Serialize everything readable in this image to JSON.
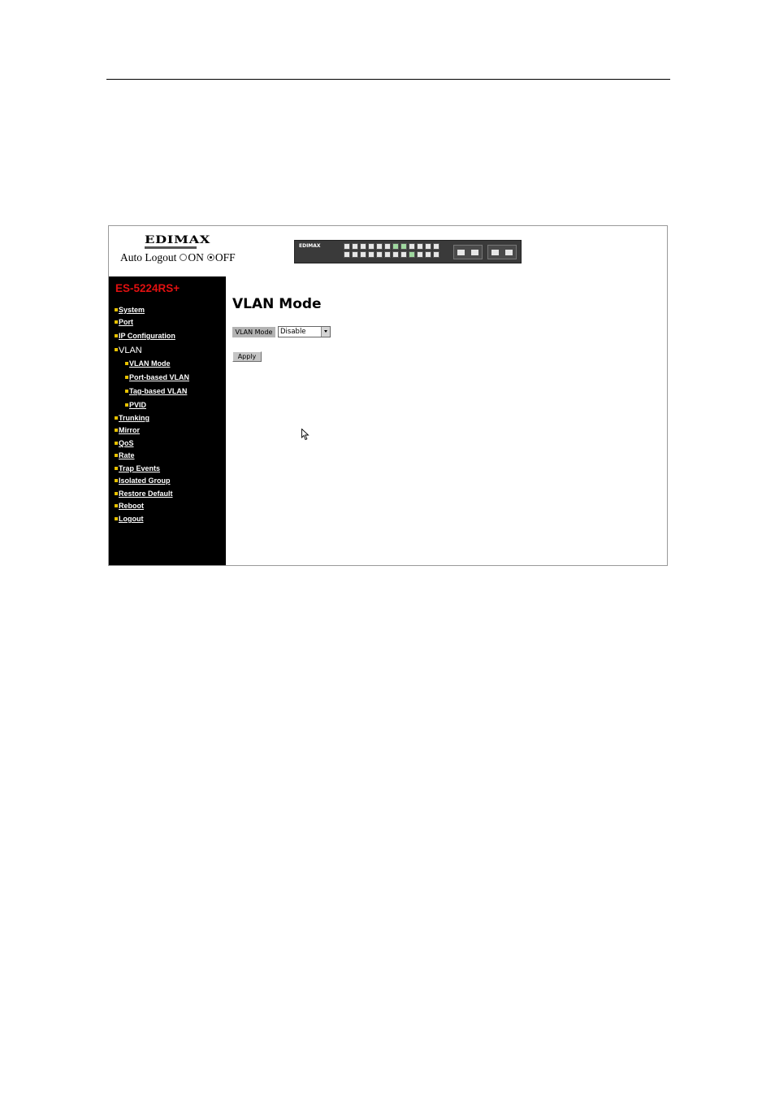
{
  "header": {
    "logo_text": "EDIMAX",
    "auto_logout_label": "Auto Logout",
    "option_on": "ON",
    "option_off": "OFF",
    "selected_option": "OFF"
  },
  "device_image": {
    "brand": "EDIMAX"
  },
  "sidebar": {
    "model": "ES-5224RS+",
    "items": [
      {
        "label": "System",
        "level": 0,
        "link": true
      },
      {
        "label": "Port",
        "level": 0,
        "link": true
      },
      {
        "label": "IP Configuration",
        "level": 0,
        "link": true
      },
      {
        "label": "VLAN",
        "level": 0,
        "link": false
      },
      {
        "label": "VLAN Mode",
        "level": 1,
        "link": true
      },
      {
        "label": "Port-based VLAN",
        "level": 1,
        "link": true
      },
      {
        "label": "Tag-based VLAN",
        "level": 1,
        "link": true
      },
      {
        "label": "PVID",
        "level": 1,
        "link": true
      },
      {
        "label": "Trunking",
        "level": 0,
        "link": true
      },
      {
        "label": "Mirror",
        "level": 0,
        "link": true
      },
      {
        "label": "QoS",
        "level": 0,
        "link": true
      },
      {
        "label": "Rate",
        "level": 0,
        "link": true
      },
      {
        "label": "Trap Events",
        "level": 0,
        "link": true
      },
      {
        "label": "Isolated Group",
        "level": 0,
        "link": true
      },
      {
        "label": "Restore Default",
        "level": 0,
        "link": true
      },
      {
        "label": "Reboot",
        "level": 0,
        "link": true
      },
      {
        "label": "Logout",
        "level": 0,
        "link": true
      }
    ]
  },
  "main": {
    "title": "VLAN Mode",
    "field_label": "VLAN Mode",
    "select_value": "Disable",
    "apply_label": "Apply"
  },
  "colors": {
    "sidebar_bg": "#000000",
    "model_text": "#e01010",
    "bullet": "#e8c200",
    "label_bg": "#b3b3b3"
  }
}
